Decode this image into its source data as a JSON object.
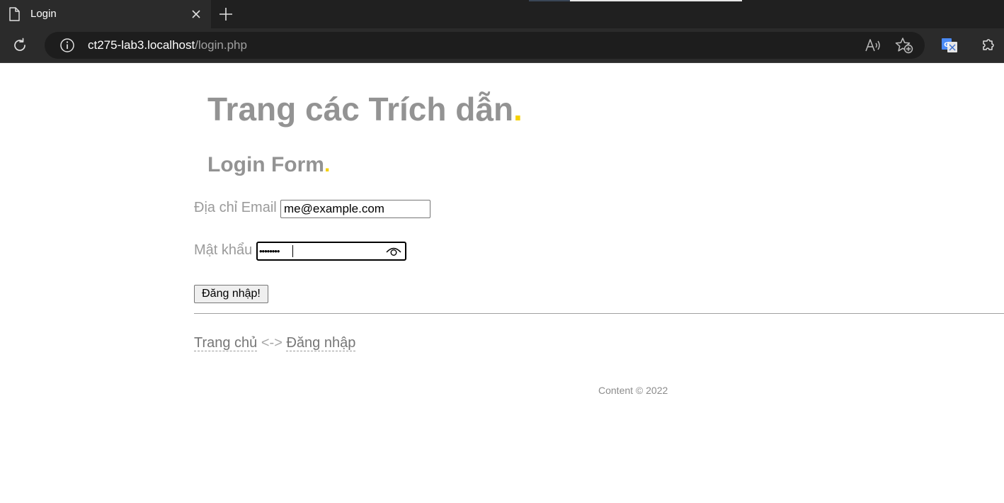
{
  "browser": {
    "tab_title": "Login",
    "url_host": "ct275-lab3.localhost",
    "url_path": "/login.php",
    "icons": [
      "document-icon",
      "close-icon",
      "new-tab-icon",
      "reload-icon",
      "site-info-icon",
      "read-aloud-icon",
      "add-favorite-icon",
      "translate-icon",
      "extensions-icon"
    ]
  },
  "page": {
    "site_title": "Trang các Trích dẫn",
    "form_title": "Login Form",
    "title_dot": ".",
    "accent_color": "#f5d000",
    "email_label": "Địa chỉ Email",
    "email_value": "me@example.com",
    "password_label": "Mật khẩu",
    "password_value": "password",
    "submit_label": "Đăng nhập!",
    "nav": {
      "home_label": "Trang chủ",
      "separator": "<->",
      "login_label": "Đăng nhập"
    },
    "footer": "Content © 2022"
  }
}
